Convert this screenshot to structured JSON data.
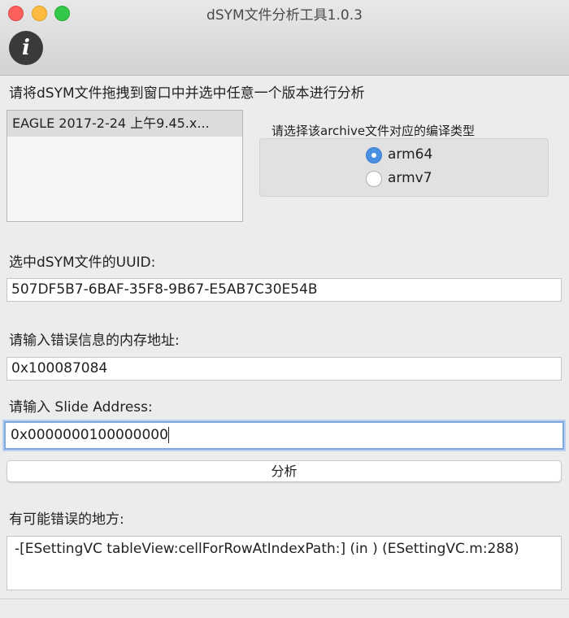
{
  "window": {
    "title": "dSYM文件分析工具1.0.3"
  },
  "toolbar": {
    "info_icon": "info-icon",
    "info_glyph": "i"
  },
  "instruction": "请将dSYM文件拖拽到窗口中并选中任意一个版本进行分析",
  "archive_list": {
    "items": [
      "EAGLE 2017-2-24 上午9.45.x..."
    ]
  },
  "arch_group": {
    "title": "请选择该archive文件对应的编译类型",
    "options": [
      {
        "label": "arm64",
        "selected": true
      },
      {
        "label": "armv7",
        "selected": false
      }
    ]
  },
  "uuid": {
    "label": "选中dSYM文件的UUID:",
    "value": "507DF5B7-6BAF-35F8-9B67-E5AB7C30E54B"
  },
  "memory_address": {
    "label": "请输入错误信息的内存地址:",
    "value": "0x100087084"
  },
  "slide_address": {
    "label": "请输入 Slide Address:",
    "value": "0x0000000100000000"
  },
  "analyze_button": {
    "label": "分析"
  },
  "result": {
    "label": "有可能错误的地方:",
    "text": "-[ESettingVC tableView:cellForRowAtIndexPath:] (in ) (ESettingVC.m:288)"
  },
  "colors": {
    "accent": "#4a90e2",
    "focus_ring": "#7fa8e0",
    "window_bg": "#ececec"
  }
}
